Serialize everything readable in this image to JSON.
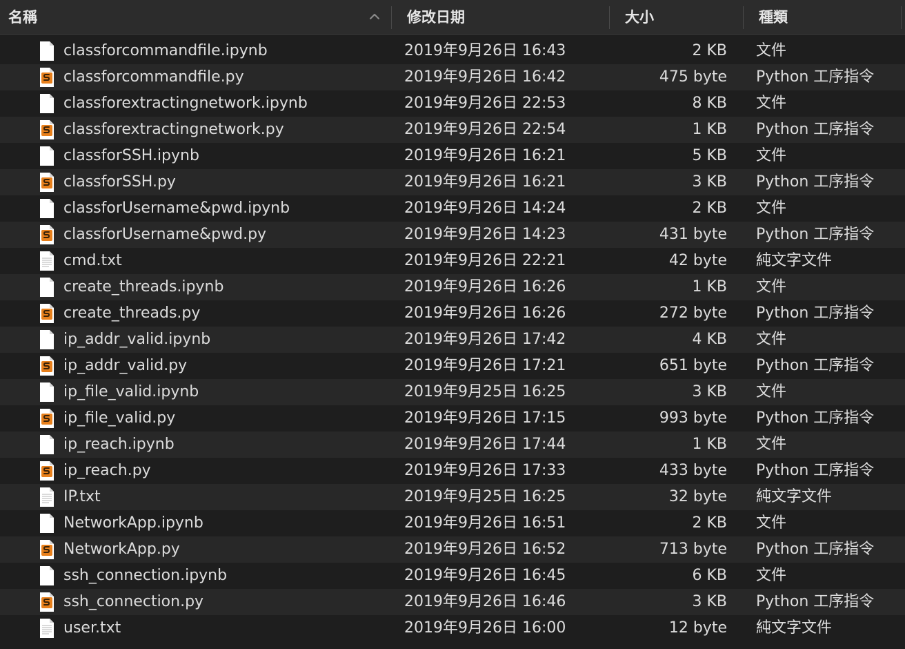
{
  "header": {
    "name": "名稱",
    "date": "修改日期",
    "size": "大小",
    "kind": "種類"
  },
  "icons": {
    "sort": "chevron-up-icon",
    "notebook": "document-icon",
    "python": "python-script-icon",
    "text": "text-document-icon"
  },
  "colors": {
    "python_badge": "#e8801c",
    "row_alt": "#282828",
    "row_base": "#1e1e1e"
  },
  "files": [
    {
      "name": "classforcommandfile.ipynb",
      "date": "2019年9月26日 16:43",
      "size": "2 KB",
      "kind": "文件",
      "icon": "notebook"
    },
    {
      "name": "classforcommandfile.py",
      "date": "2019年9月26日 16:42",
      "size": "475 byte",
      "kind": "Python 工序指令",
      "icon": "python"
    },
    {
      "name": "classforextractingnetwork.ipynb",
      "date": "2019年9月26日 22:53",
      "size": "8 KB",
      "kind": "文件",
      "icon": "notebook"
    },
    {
      "name": "classforextractingnetwork.py",
      "date": "2019年9月26日 22:54",
      "size": "1 KB",
      "kind": "Python 工序指令",
      "icon": "python"
    },
    {
      "name": "classforSSH.ipynb",
      "date": "2019年9月26日 16:21",
      "size": "5 KB",
      "kind": "文件",
      "icon": "notebook"
    },
    {
      "name": "classforSSH.py",
      "date": "2019年9月26日 16:21",
      "size": "3 KB",
      "kind": "Python 工序指令",
      "icon": "python"
    },
    {
      "name": "classforUsername&pwd.ipynb",
      "date": "2019年9月26日 14:24",
      "size": "2 KB",
      "kind": "文件",
      "icon": "notebook"
    },
    {
      "name": "classforUsername&pwd.py",
      "date": "2019年9月26日 14:23",
      "size": "431 byte",
      "kind": "Python 工序指令",
      "icon": "python"
    },
    {
      "name": "cmd.txt",
      "date": "2019年9月26日 22:21",
      "size": "42 byte",
      "kind": "純文字文件",
      "icon": "text"
    },
    {
      "name": "create_threads.ipynb",
      "date": "2019年9月26日 16:26",
      "size": "1 KB",
      "kind": "文件",
      "icon": "notebook"
    },
    {
      "name": "create_threads.py",
      "date": "2019年9月26日 16:26",
      "size": "272 byte",
      "kind": "Python 工序指令",
      "icon": "python"
    },
    {
      "name": "ip_addr_valid.ipynb",
      "date": "2019年9月26日 17:42",
      "size": "4 KB",
      "kind": "文件",
      "icon": "notebook"
    },
    {
      "name": "ip_addr_valid.py",
      "date": "2019年9月26日 17:21",
      "size": "651 byte",
      "kind": "Python 工序指令",
      "icon": "python"
    },
    {
      "name": "ip_file_valid.ipynb",
      "date": "2019年9月25日 16:25",
      "size": "3 KB",
      "kind": "文件",
      "icon": "notebook"
    },
    {
      "name": "ip_file_valid.py",
      "date": "2019年9月26日 17:15",
      "size": "993 byte",
      "kind": "Python 工序指令",
      "icon": "python"
    },
    {
      "name": "ip_reach.ipynb",
      "date": "2019年9月26日 17:44",
      "size": "1 KB",
      "kind": "文件",
      "icon": "notebook"
    },
    {
      "name": "ip_reach.py",
      "date": "2019年9月26日 17:33",
      "size": "433 byte",
      "kind": "Python 工序指令",
      "icon": "python"
    },
    {
      "name": "IP.txt",
      "date": "2019年9月25日 16:25",
      "size": "32 byte",
      "kind": "純文字文件",
      "icon": "text"
    },
    {
      "name": "NetworkApp.ipynb",
      "date": "2019年9月26日 16:51",
      "size": "2 KB",
      "kind": "文件",
      "icon": "notebook"
    },
    {
      "name": "NetworkApp.py",
      "date": "2019年9月26日 16:52",
      "size": "713 byte",
      "kind": "Python 工序指令",
      "icon": "python"
    },
    {
      "name": "ssh_connection.ipynb",
      "date": "2019年9月26日 16:45",
      "size": "6 KB",
      "kind": "文件",
      "icon": "notebook"
    },
    {
      "name": "ssh_connection.py",
      "date": "2019年9月26日 16:46",
      "size": "3 KB",
      "kind": "Python 工序指令",
      "icon": "python"
    },
    {
      "name": "user.txt",
      "date": "2019年9月26日 16:00",
      "size": "12 byte",
      "kind": "純文字文件",
      "icon": "text"
    }
  ]
}
